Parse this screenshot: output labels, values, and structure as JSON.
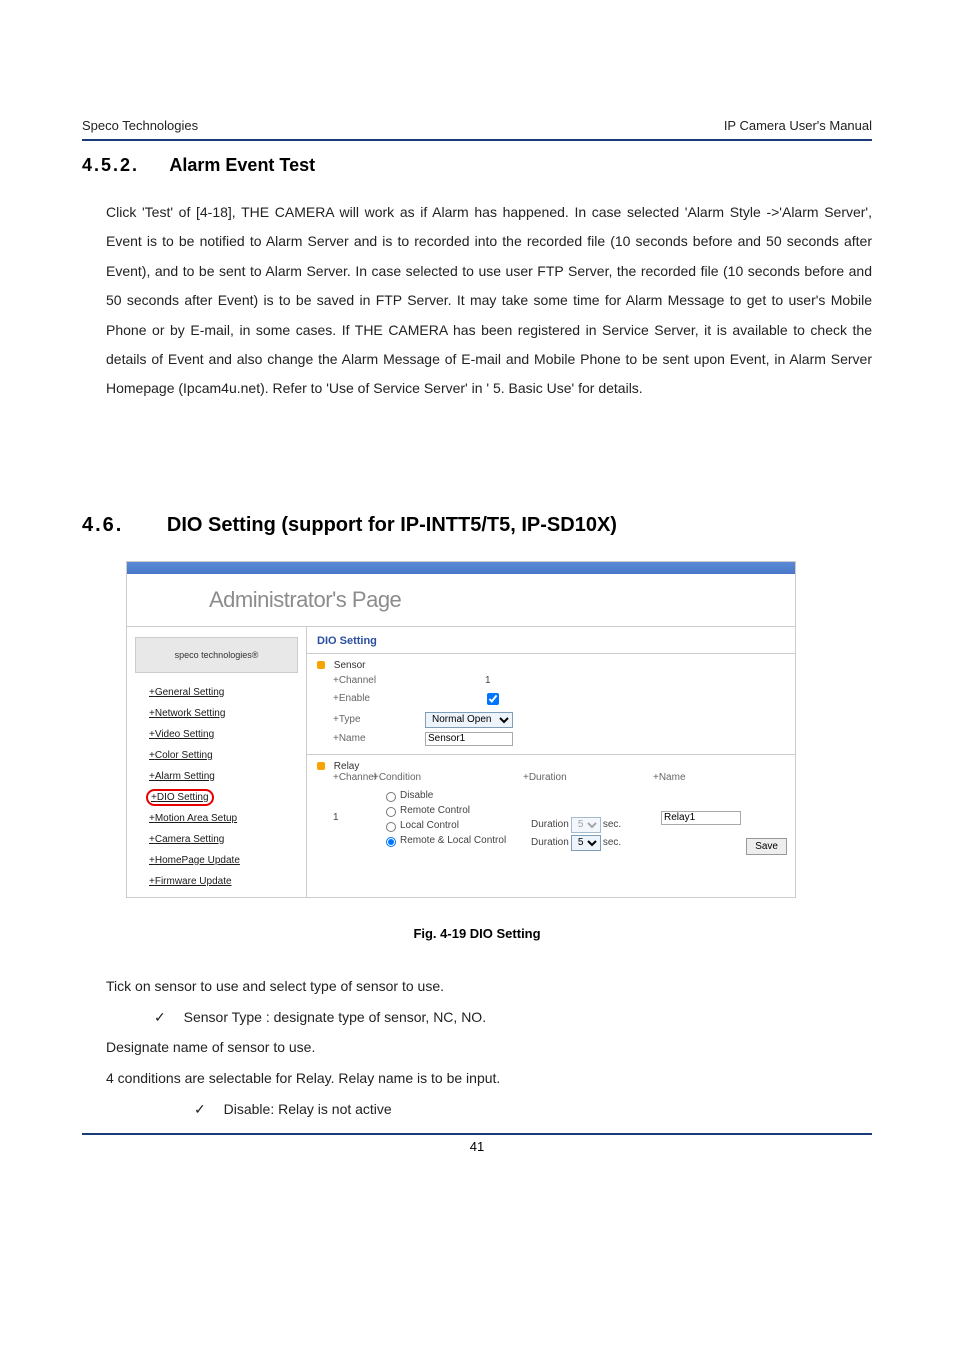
{
  "header": {
    "left": "Speco Technologies",
    "right": "IP Camera User's Manual"
  },
  "section": {
    "num": "4.5.2.",
    "title": "Alarm Event Test",
    "body": "Click 'Test' of [4-18], THE CAMERA will work as if Alarm has happened. In case selected 'Alarm Style  ->'Alarm Server', Event is to be notified to Alarm Server and is to recorded into the recorded file (10 seconds before and 50 seconds after Event), and to be sent to Alarm Server. In case selected to use user FTP Server, the recorded file (10 seconds before and 50 seconds after Event) is to be saved in FTP Server. It may take some time for Alarm Message to get to user's Mobile Phone or by E-mail, in some cases. If THE CAMERA has been registered in Service Server, it is available to check the details of Event and also change the Alarm Message of E-mail and Mobile Phone to be sent upon Event, in Alarm Server Homepage (Ipcam4u.net). Refer to 'Use of Service Server' in ' 5. Basic Use'  for details."
  },
  "main": {
    "num": "4.6.",
    "title": "DIO Setting (support for IP-INTT5/T5, IP-SD10X)"
  },
  "figure": {
    "page_title": "Administrator's Page",
    "side_logo": "speco technologies®",
    "nav": [
      "General Setting",
      "Network Setting",
      "Video Setting",
      "Color Setting",
      "Alarm Setting",
      "DIO Setting",
      "Motion Area Setup",
      "Camera Setting",
      "HomePage Update",
      "Firmware Update"
    ],
    "panel_title": "DIO Setting",
    "sensor": {
      "block": "Sensor",
      "channel_lbl": "+Channel",
      "channel_val": "1",
      "enable_lbl": "+Enable",
      "type_lbl": "+Type",
      "type_val": "Normal Open",
      "name_lbl": "+Name",
      "name_val": "Sensor1"
    },
    "relay": {
      "block": "Relay",
      "h_channel": "+Channel",
      "h_condition": "+Condition",
      "h_duration": "+Duration",
      "h_name": "+Name",
      "ch_val": "1",
      "c1": "Disable",
      "c2": "Remote Control",
      "c3": "Local Control",
      "c4": "Remote & Local Control",
      "dur_label": "Duration",
      "dur_val": "5",
      "dur_unit": "sec.",
      "name_val": "Relay1",
      "save": "Save"
    },
    "caption": "Fig.  4-19 DIO Setting"
  },
  "desc": {
    "l1": "Tick on sensor to use and select type of sensor to use.",
    "l2": "Sensor Type :  designate type of sensor, NC, NO.",
    "l3": "Designate name of sensor to use.",
    "l4": "4 conditions are selectable for Relay. Relay name is to be input.",
    "l5": "Disable:  Relay is not active"
  },
  "page_number": "41"
}
